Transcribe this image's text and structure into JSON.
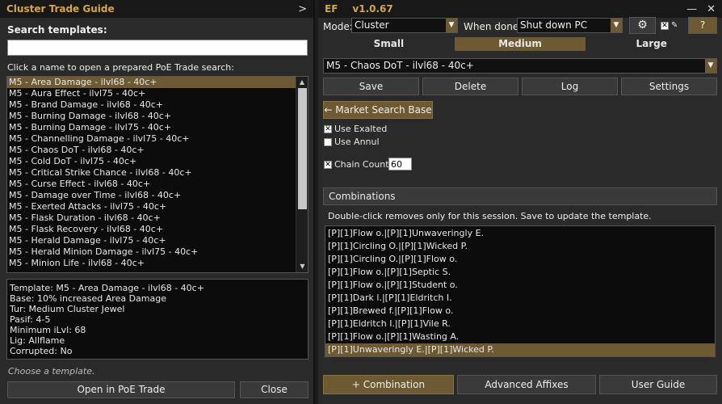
{
  "left": {
    "title": "Cluster Trade Guide",
    "collapse_icon": "chevron-right-icon",
    "search_label": "Search templates:",
    "search_value": "",
    "hint": "Click a name to open a prepared PoE Trade search:",
    "templates": [
      "M5 - Area Damage - ilvl68 - 40c+",
      "M5 - Aura Effect - ilvl75 - 40c+",
      "M5 - Brand Damage - ilvl68 - 40c+",
      "M5 - Burning Damage - ilvl68 - 40c+",
      "M5 - Burning Damage - ilvl75 - 40c+",
      "M5 - Channelling Damage - ilvl75 - 40c+",
      "M5 - Chaos DoT - ilvl68 - 40c+",
      "M5 - Cold DoT - ilvl75 - 40c+",
      "M5 - Critical Strike Chance - ilvl68 - 40c+",
      "M5 - Curse Effect - ilvl68 - 40c+",
      "M5 - Damage over Time - ilvl68 - 40c+",
      "M5 - Exerted Attacks - ilvl75 - 40c+",
      "M5 - Flask Duration - ilvl68 - 40c+",
      "M5 - Flask Recovery - ilvl68 - 40c+",
      "M5 - Herald Damage - ilvl75 - 40c+",
      "M5 - Herald Minion Damage - ilvl75 - 40c+",
      "M5 - Minion Life - ilvl68 - 40c+"
    ],
    "selected_index": 0,
    "details": [
      "Template: M5 - Area Damage - ilvl68 - 40c+",
      "Base: 10% increased Area Damage",
      "Tur: Medium Cluster Jewel",
      "Pasif: 4-5",
      "Minimum iLvl: 68",
      "Lig: Allflame",
      "Corrupted: No"
    ],
    "status": "Choose a template.",
    "open_button": "Open in PoE Trade",
    "close_button": "Close"
  },
  "right": {
    "title": "EF",
    "version": "v1.0.67",
    "minimize_icon": "minimize-icon",
    "close_icon": "close-icon",
    "mode_label": "Mode:",
    "mode_value": "Cluster",
    "when_done_label": "When done:",
    "when_done_value": "Shut down PC",
    "settings_icon": "gear-icon",
    "pin_icon": "pin-icon",
    "help_label": "?",
    "tabs": [
      "Small",
      "Medium",
      "Large"
    ],
    "active_tab": 1,
    "template_value": "M5 - Chaos DoT - ilvl68 - 40c+",
    "actions": [
      "Save",
      "Delete",
      "Log",
      "Settings"
    ],
    "market_button": "← Market Search Base",
    "use_exalted_label": "Use Exalted",
    "use_exalted": true,
    "use_annul_label": "Use Annul",
    "use_annul": false,
    "chain_label": "Chain Count:",
    "chain_value": "60",
    "chain_checked": true,
    "combinations_title": "Combinations",
    "combinations_hint": "Double-click removes only for this session. Save to update the template.",
    "combinations": [
      "[P][1]Flow o.|[P][1]Unwaveringly E.",
      "[P][1]Circling O.|[P][1]Wicked P.",
      "[P][1]Circling O.|[P][1]Flow o.",
      "[P][1]Flow o.|[P][1]Septic S.",
      "[P][1]Flow o.|[P][1]Student o.",
      "[P][1]Dark l.|[P][1]Eldritch I.",
      "[P][1]Brewed f.|[P][1]Flow o.",
      "[P][1]Eldritch I.|[P][1]Vile R.",
      "[P][1]Flow o.|[P][1]Wasting A.",
      "[P][1]Unwaveringly E.|[P][1]Wicked P."
    ],
    "selected_combination": 9,
    "add_combination": "+ Combination",
    "advanced_affixes": "Advanced Affixes",
    "user_guide": "User Guide",
    "accent": "#6e5a32",
    "title_color": "#d6a64a"
  }
}
